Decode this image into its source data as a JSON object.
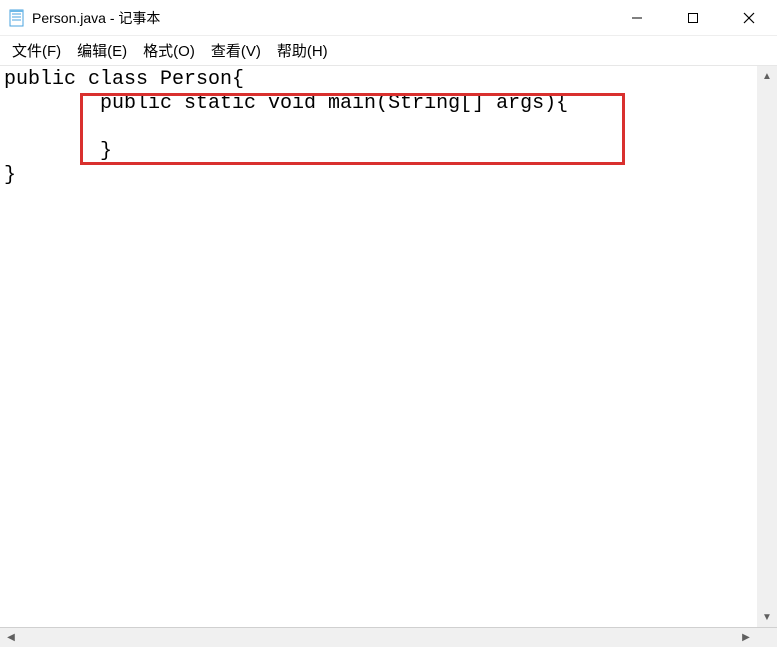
{
  "window": {
    "title": "Person.java - 记事本"
  },
  "menu": {
    "file": "文件(F)",
    "edit": "编辑(E)",
    "format": "格式(O)",
    "view": "查看(V)",
    "help": "帮助(H)"
  },
  "editor": {
    "content": "public class Person{\n        public static void main(String[] args){\n\n        }\n}"
  }
}
